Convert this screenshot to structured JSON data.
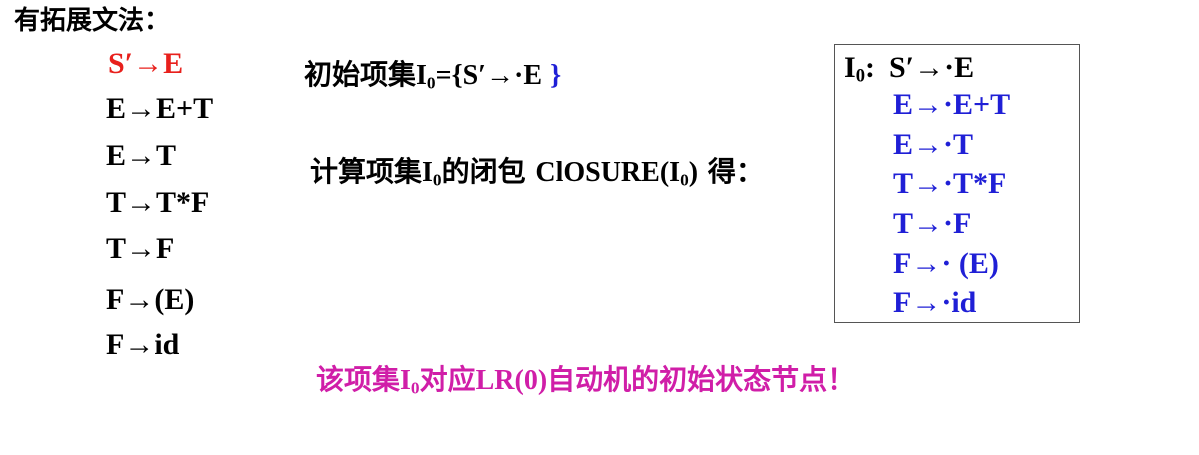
{
  "title": "有拓展文法：",
  "grammar": {
    "start_production": "S′→E",
    "productions": [
      "E→E+T",
      "E→T",
      "T→T*F",
      "T→F",
      "F→(E)",
      "F→id"
    ]
  },
  "initial_item": {
    "label": "初始项集",
    "item_symbol": "I",
    "item_subscript": "0",
    "equals_open": "={",
    "item": "S′→·E",
    "close": "}"
  },
  "closure_line": {
    "prefix": "计算项集",
    "item_symbol": "I",
    "item_subscript": "0",
    "text1": "的闭包 ",
    "closure_word": "ClOSURE(I",
    "closure_subscript": "0",
    "closure_end": ")",
    "suffix": " 得："
  },
  "closure_box": {
    "label_symbol": "I",
    "label_subscript": "0",
    "label_colon": ":",
    "kernel_item": "S′→·E",
    "items": [
      "E→·E+T",
      "E→·T",
      "T→·T*F",
      "T→·F",
      "F→· (E)",
      "F→·id"
    ]
  },
  "note": {
    "prefix": "该项集",
    "item_symbol": "I",
    "item_subscript": "0",
    "text1": "对应",
    "automaton": "LR(0)",
    "suffix": "自动机的初始状态节点！"
  },
  "colors": {
    "black": "#000000",
    "red": "#e8201c",
    "blue": "#1f1fd6",
    "magenta": "#d01ea8",
    "box_border": "#555555"
  }
}
